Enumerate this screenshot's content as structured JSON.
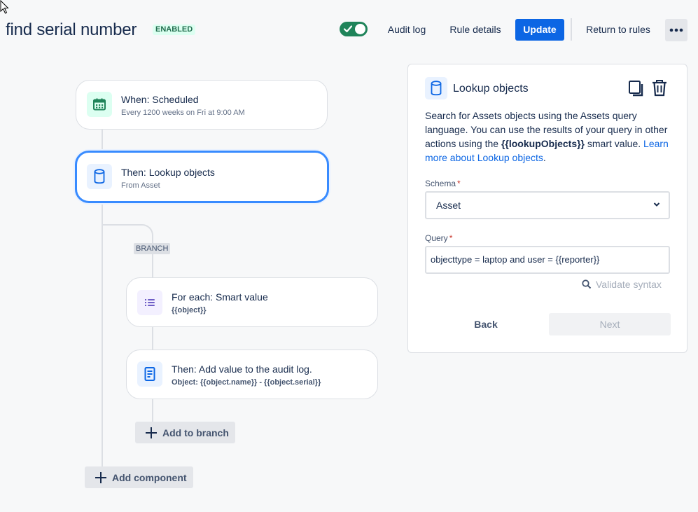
{
  "header": {
    "title": "find serial number",
    "status_badge": "ENABLED",
    "toggle_on": true,
    "audit_log": "Audit log",
    "rule_details": "Rule details",
    "update": "Update",
    "return_to_rules": "Return to rules",
    "more_icon": "more-horizontal-icon"
  },
  "flow": {
    "trigger": {
      "title": "When: Scheduled",
      "subtitle": "Every 1200 weeks on Fri at 9:00 AM",
      "icon": "calendar-icon"
    },
    "lookup": {
      "title": "Then: Lookup objects",
      "subtitle": "From Asset",
      "icon": "database-icon"
    },
    "branch_label": "BRANCH",
    "for_each": {
      "title": "For each: Smart value",
      "subtitle": "{{object}}",
      "icon": "list-icon"
    },
    "audit": {
      "title": "Then: Add value to the audit log.",
      "subtitle": "Object: {{object.name}} - {{object.serial}}",
      "icon": "document-icon"
    },
    "add_to_branch": "Add to branch",
    "add_component": "Add component"
  },
  "panel": {
    "title": "Lookup objects",
    "desc_part1": "Search for Assets objects using the Assets query language. You can use the results of your query in other actions using the ",
    "desc_bold": "{{lookupObjects}}",
    "desc_part2": " smart value. ",
    "desc_link": "Learn more about Lookup objects",
    "desc_end": ".",
    "schema_label": "Schema",
    "schema_value": "Asset",
    "query_label": "Query",
    "query_value": "objecttype = laptop and user = {{reporter}}",
    "validate": "Validate syntax",
    "back": "Back",
    "next": "Next"
  },
  "colors": {
    "primary": "#0c66e4",
    "toggle_on": "#1f845a",
    "selected_border": "#388bff",
    "badge_bg": "#dcfff1",
    "badge_text": "#216e4e",
    "required": "#c9372c"
  }
}
